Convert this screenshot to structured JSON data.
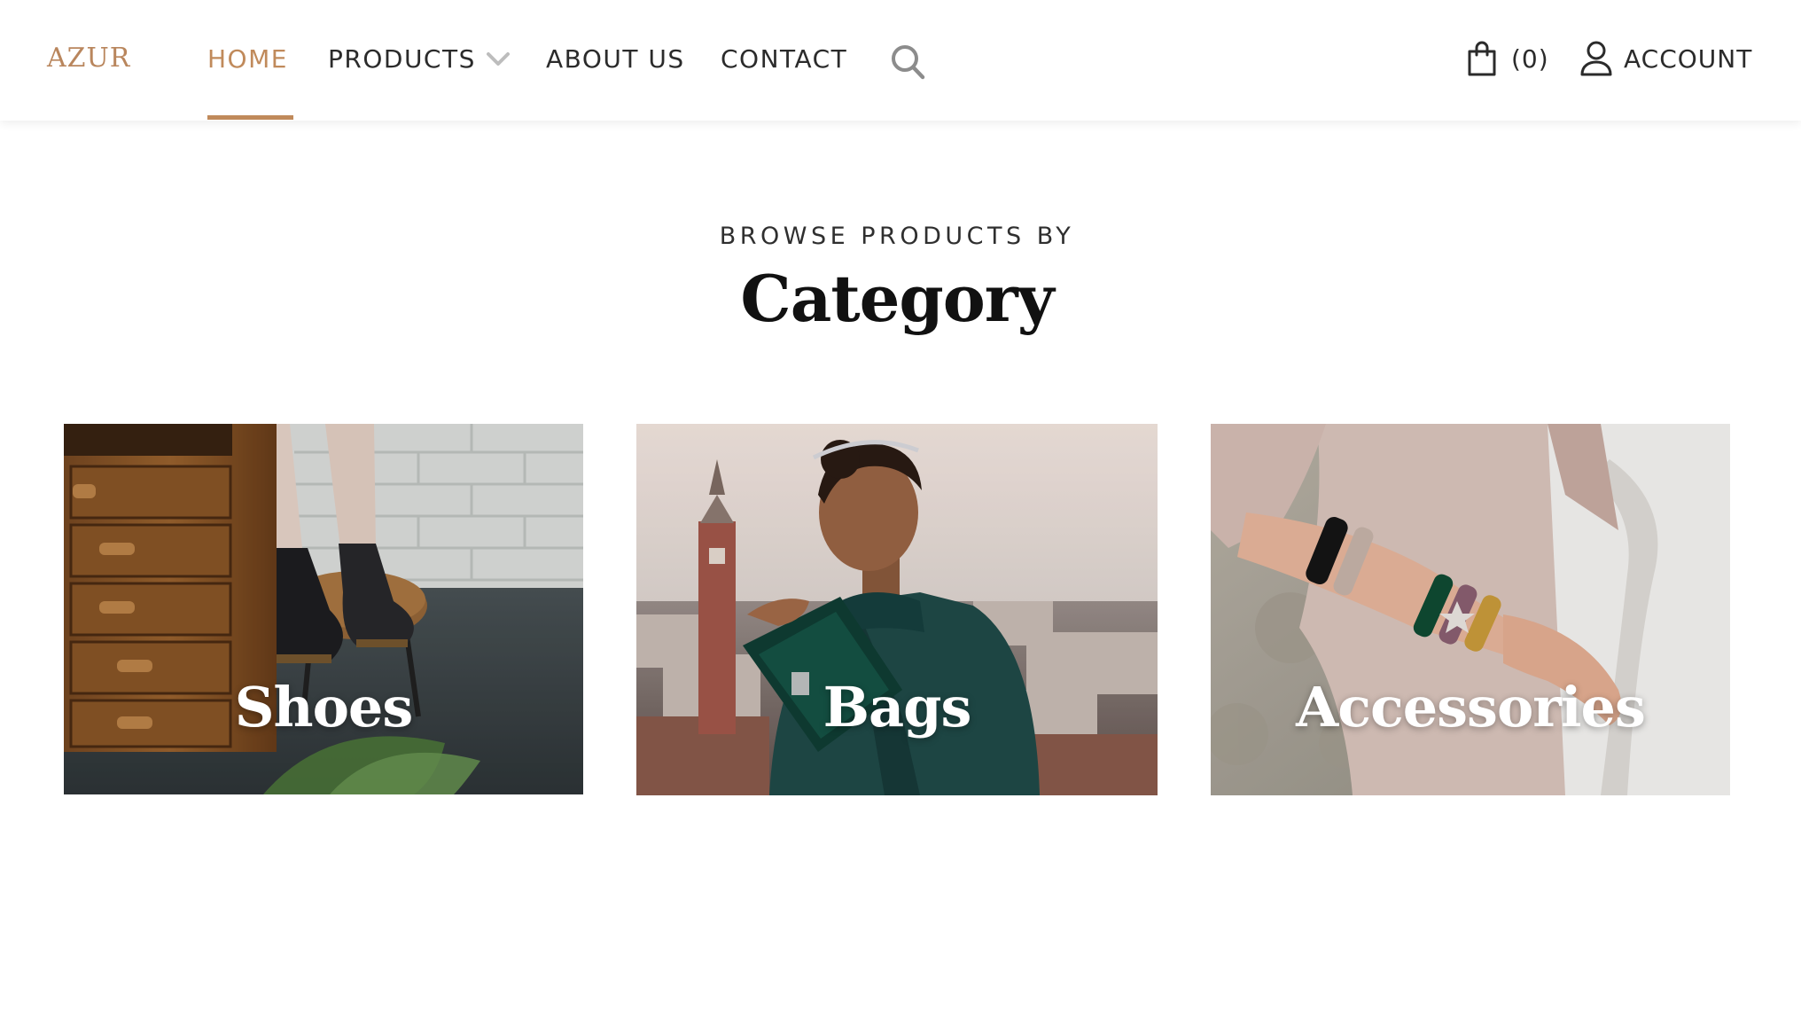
{
  "brand": {
    "logo": "AZUR",
    "accent_color": "#c08a5b"
  },
  "nav": {
    "items": [
      {
        "label": "HOME",
        "active": true
      },
      {
        "label": "PRODUCTS",
        "has_dropdown": true
      },
      {
        "label": "ABOUT US"
      },
      {
        "label": "CONTACT"
      }
    ],
    "search_icon": "search-icon"
  },
  "header_right": {
    "cart_count": "(0)",
    "cart_icon": "shopping-bag-icon",
    "account_label": "ACCOUNT",
    "account_icon": "user-icon"
  },
  "section": {
    "eyebrow": "BROWSE PRODUCTS BY",
    "title": "Category"
  },
  "categories": [
    {
      "label": "Shoes"
    },
    {
      "label": "Bags"
    },
    {
      "label": "Accessories"
    }
  ]
}
